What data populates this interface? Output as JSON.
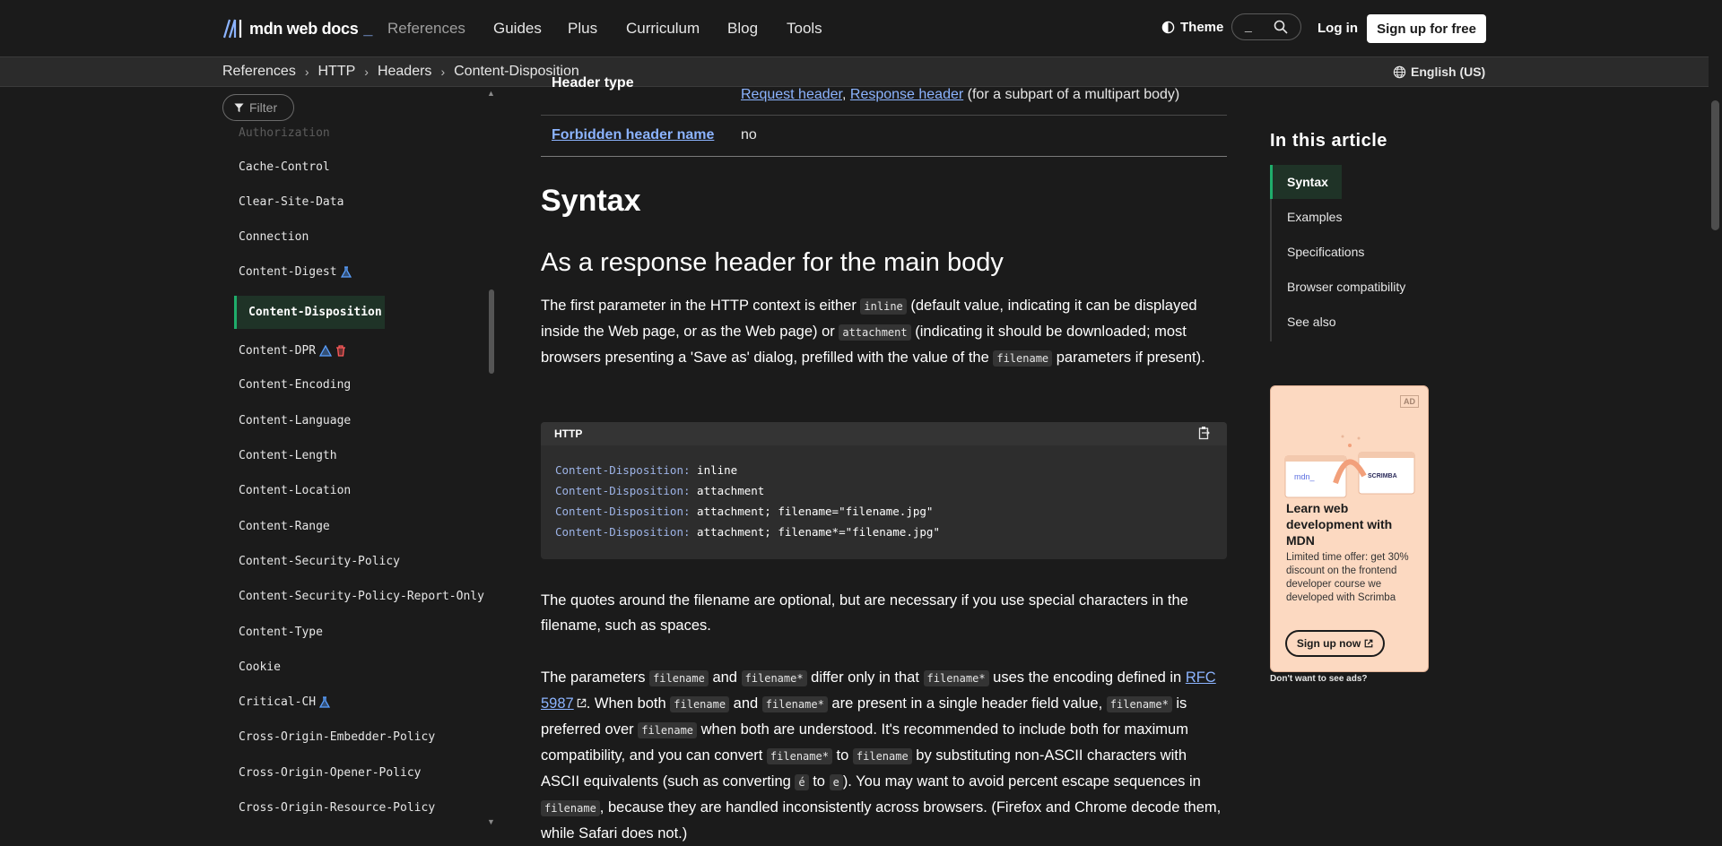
{
  "nav": {
    "logo_text": "mdn web docs",
    "logo_cursor": "_",
    "items": [
      "References",
      "Guides",
      "Plus",
      "Curriculum",
      "Blog",
      "Tools"
    ],
    "theme_label": "Theme",
    "search_placeholder": "_",
    "login_label": "Log in",
    "signup_label": "Sign up for free"
  },
  "breadcrumb": [
    "References",
    "HTTP",
    "Headers",
    "Content-Disposition"
  ],
  "language": "English (US)",
  "sidebar": {
    "filter_placeholder": "Filter",
    "faded_item": "Authorization",
    "items": [
      {
        "label": "Cache-Control"
      },
      {
        "label": "Clear-Site-Data"
      },
      {
        "label": "Connection"
      },
      {
        "label": "Content-Digest",
        "icons": [
          "experimental-icon"
        ]
      },
      {
        "label": "Content-Disposition",
        "active": true
      },
      {
        "label": "Content-DPR",
        "icons": [
          "experimental-icon",
          "deprecated-icon"
        ]
      },
      {
        "label": "Content-Encoding"
      },
      {
        "label": "Content-Language"
      },
      {
        "label": "Content-Length"
      },
      {
        "label": "Content-Location"
      },
      {
        "label": "Content-Range"
      },
      {
        "label": "Content-Security-Policy"
      },
      {
        "label": "Content-Security-Policy-Report-Only"
      },
      {
        "label": "Content-Type"
      },
      {
        "label": "Cookie"
      },
      {
        "label": "Critical-CH",
        "icons": [
          "experimental-icon"
        ]
      },
      {
        "label": "Cross-Origin-Embedder-Policy"
      },
      {
        "label": "Cross-Origin-Opener-Policy"
      },
      {
        "label": "Cross-Origin-Resource-Policy"
      }
    ]
  },
  "main": {
    "table": {
      "row1_header": "Header type",
      "row1_link1": "Request header",
      "row1_comma": ",",
      "row1_link2": "Response header",
      "row1_tail": "(for a subpart of a multipart body)",
      "row2_header": "Forbidden header name",
      "row2_value": "no"
    },
    "h1": "Syntax",
    "h2": "As a response header for the main body",
    "p1": {
      "t1": "The first parameter in the HTTP context is either ",
      "c1": "inline",
      "t2": " (default value, indicating it can be displayed inside the Web page, or as the Web page) or ",
      "c2": "attachment",
      "t3": " (indicating it should be downloaded; most browsers presenting a 'Save as' dialog, prefilled with the value of the ",
      "c3": "filename",
      "t4": " parameters if present)."
    },
    "code": {
      "lang": "HTTP",
      "lines": [
        {
          "key": "Content-Disposition:",
          "val": " inline"
        },
        {
          "key": "Content-Disposition:",
          "val": " attachment"
        },
        {
          "key": "Content-Disposition:",
          "val": " attachment; filename=\"filename.jpg\""
        },
        {
          "key": "Content-Disposition:",
          "val": " attachment; filename*=\"filename.jpg\""
        }
      ]
    },
    "p2": "The quotes around the filename are optional, but are necessary if you use special characters in the filename, such as spaces.",
    "p3": {
      "t1": "The parameters ",
      "c1": "filename",
      "t2": " and ",
      "c2": "filename*",
      "t3": " differ only in that ",
      "c3": "filename*",
      "t4": " uses the encoding defined in ",
      "link": "RFC 5987",
      "t5": ". When both ",
      "c4": "filename",
      "t6": " and ",
      "c5": "filename*",
      "t7": " are present in a single header field value, ",
      "c6": "filename*",
      "t8": " is preferred over ",
      "c7": "filename",
      "t9": " when both are understood. It's recommended to include both for maximum compatibility, and you can convert ",
      "c8": "filename*",
      "t10": " to ",
      "c9": "filename",
      "t11": " by substituting non-ASCII characters with ASCII equivalents (such as converting ",
      "c10": "é",
      "t12": " to ",
      "c11": "e",
      "t13": "). You may want to avoid percent escape sequences in ",
      "c12": "filename",
      "t14": ", because they are handled inconsistently across browsers. (Firefox and Chrome decode them, while Safari does not.)"
    }
  },
  "toc": {
    "title": "In this article",
    "items": [
      "Syntax",
      "Examples",
      "Specifications",
      "Browser compatibility",
      "See also"
    ]
  },
  "ad": {
    "badge": "AD",
    "headline": "Learn web development with MDN",
    "body": "Limited time offer: get 30% discount on the frontend developer course we developed with Scrimba",
    "button": "Sign up now",
    "art_left": "mdn_",
    "art_right": "SCRIMBA",
    "no_ads": "Don't want to see ads?"
  },
  "colors": {
    "background": "#1b1b1b",
    "link": "#8cb4ff",
    "active_green": "#1fad6b",
    "ad_background": "#fcd9c1"
  }
}
